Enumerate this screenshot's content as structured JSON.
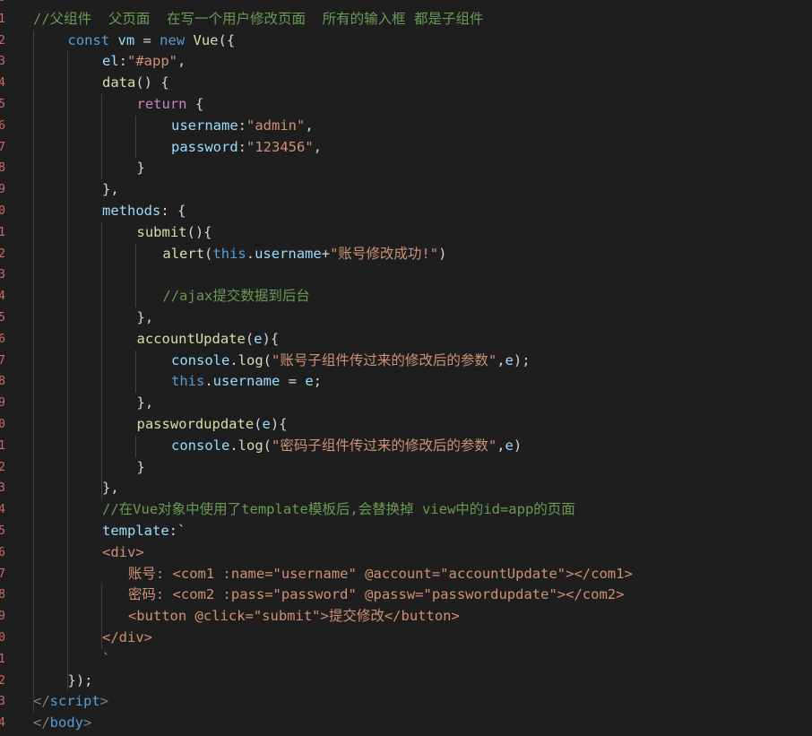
{
  "editor": {
    "line_numbers": [
      "0",
      "1",
      "2",
      "3",
      "4",
      "5",
      "6",
      "7",
      "8",
      "9",
      "0",
      "1",
      "2",
      "3",
      "4",
      "5",
      "6",
      "7",
      "8",
      "9",
      "0",
      "1",
      "2",
      "3",
      "4",
      "5",
      "6",
      "7",
      "8",
      "9",
      "0",
      "1",
      "2",
      "3",
      "4"
    ],
    "lines": [
      {
        "indent": 0,
        "tokens": []
      },
      {
        "indent": 0,
        "tokens": [
          {
            "t": "//父组件  父页面  在写一个用户修改页面  所有的输入框 都是子组件",
            "c": "c-cmt"
          }
        ]
      },
      {
        "indent": 1,
        "tokens": [
          {
            "t": "const ",
            "c": "c-kw"
          },
          {
            "t": "vm",
            "c": "c-var"
          },
          {
            "t": " = ",
            "c": "c-txt"
          },
          {
            "t": "new ",
            "c": "c-kw"
          },
          {
            "t": "Vue",
            "c": "c-fn"
          },
          {
            "t": "({",
            "c": "c-txt"
          }
        ]
      },
      {
        "indent": 2,
        "tokens": [
          {
            "t": "el",
            "c": "c-var"
          },
          {
            "t": ":",
            "c": "c-txt"
          },
          {
            "t": "\"#app\"",
            "c": "c-str"
          },
          {
            "t": ",",
            "c": "c-txt"
          }
        ]
      },
      {
        "indent": 2,
        "tokens": [
          {
            "t": "data",
            "c": "c-fn"
          },
          {
            "t": "() {",
            "c": "c-txt"
          }
        ]
      },
      {
        "indent": 3,
        "tokens": [
          {
            "t": "return",
            "c": "c-ctl"
          },
          {
            "t": " {",
            "c": "c-txt"
          }
        ]
      },
      {
        "indent": 4,
        "tokens": [
          {
            "t": "username",
            "c": "c-var"
          },
          {
            "t": ":",
            "c": "c-txt"
          },
          {
            "t": "\"admin\"",
            "c": "c-str"
          },
          {
            "t": ",",
            "c": "c-txt"
          }
        ]
      },
      {
        "indent": 4,
        "tokens": [
          {
            "t": "password",
            "c": "c-var"
          },
          {
            "t": ":",
            "c": "c-txt"
          },
          {
            "t": "\"123456\"",
            "c": "c-str"
          },
          {
            "t": ",",
            "c": "c-txt"
          }
        ]
      },
      {
        "indent": 3,
        "tokens": [
          {
            "t": "}",
            "c": "c-txt"
          }
        ]
      },
      {
        "indent": 2,
        "tokens": [
          {
            "t": "},",
            "c": "c-txt"
          }
        ]
      },
      {
        "indent": 2,
        "tokens": [
          {
            "t": "methods",
            "c": "c-var"
          },
          {
            "t": ": {",
            "c": "c-txt"
          }
        ]
      },
      {
        "indent": 3,
        "tokens": [
          {
            "t": "submit",
            "c": "c-fn"
          },
          {
            "t": "(){",
            "c": "c-txt"
          }
        ]
      },
      {
        "indent": 3.75,
        "tokens": [
          {
            "t": "alert",
            "c": "c-fn"
          },
          {
            "t": "(",
            "c": "c-txt"
          },
          {
            "t": "this",
            "c": "c-kw"
          },
          {
            "t": ".",
            "c": "c-txt"
          },
          {
            "t": "username",
            "c": "c-var"
          },
          {
            "t": "+",
            "c": "c-txt"
          },
          {
            "t": "\"账号修改成功!\"",
            "c": "c-str"
          },
          {
            "t": ")",
            "c": "c-txt"
          }
        ]
      },
      {
        "indent": 0,
        "tokens": []
      },
      {
        "indent": 3.75,
        "tokens": [
          {
            "t": "//ajax提交数据到后台",
            "c": "c-cmt"
          }
        ]
      },
      {
        "indent": 3,
        "tokens": [
          {
            "t": "},",
            "c": "c-txt"
          }
        ]
      },
      {
        "indent": 3,
        "tokens": [
          {
            "t": "accountUpdate",
            "c": "c-fn"
          },
          {
            "t": "(",
            "c": "c-txt"
          },
          {
            "t": "e",
            "c": "c-var"
          },
          {
            "t": "){",
            "c": "c-txt"
          }
        ]
      },
      {
        "indent": 4,
        "tokens": [
          {
            "t": "console",
            "c": "c-var"
          },
          {
            "t": ".",
            "c": "c-txt"
          },
          {
            "t": "log",
            "c": "c-fn"
          },
          {
            "t": "(",
            "c": "c-txt"
          },
          {
            "t": "\"账号子组件传过来的修改后的参数\"",
            "c": "c-str"
          },
          {
            "t": ",",
            "c": "c-txt"
          },
          {
            "t": "e",
            "c": "c-var"
          },
          {
            "t": ");",
            "c": "c-txt"
          }
        ]
      },
      {
        "indent": 4,
        "tokens": [
          {
            "t": "this",
            "c": "c-kw"
          },
          {
            "t": ".",
            "c": "c-txt"
          },
          {
            "t": "username",
            "c": "c-var"
          },
          {
            "t": " = ",
            "c": "c-txt"
          },
          {
            "t": "e",
            "c": "c-var"
          },
          {
            "t": ";",
            "c": "c-txt"
          }
        ]
      },
      {
        "indent": 3,
        "tokens": [
          {
            "t": "},",
            "c": "c-txt"
          }
        ]
      },
      {
        "indent": 3,
        "tokens": [
          {
            "t": "passwordupdate",
            "c": "c-fn"
          },
          {
            "t": "(",
            "c": "c-txt"
          },
          {
            "t": "e",
            "c": "c-var"
          },
          {
            "t": "){",
            "c": "c-txt"
          }
        ]
      },
      {
        "indent": 4,
        "tokens": [
          {
            "t": "console",
            "c": "c-var"
          },
          {
            "t": ".",
            "c": "c-txt"
          },
          {
            "t": "log",
            "c": "c-fn"
          },
          {
            "t": "(",
            "c": "c-txt"
          },
          {
            "t": "\"密码子组件传过来的修改后的参数\"",
            "c": "c-str"
          },
          {
            "t": ",",
            "c": "c-txt"
          },
          {
            "t": "e",
            "c": "c-var"
          },
          {
            "t": ")",
            "c": "c-txt"
          }
        ]
      },
      {
        "indent": 3,
        "tokens": [
          {
            "t": "}",
            "c": "c-txt"
          }
        ]
      },
      {
        "indent": 2,
        "tokens": [
          {
            "t": "},",
            "c": "c-txt"
          }
        ]
      },
      {
        "indent": 2,
        "tokens": [
          {
            "t": "//在Vue对象中使用了template模板后,会替换掉 view中的id=app的页面",
            "c": "c-cmt"
          }
        ]
      },
      {
        "indent": 2,
        "tokens": [
          {
            "t": "template",
            "c": "c-var"
          },
          {
            "t": ":`",
            "c": "c-txt"
          }
        ]
      },
      {
        "indent": 2,
        "tokens": [
          {
            "t": "<div>",
            "c": "c-str"
          }
        ]
      },
      {
        "indent": 2.75,
        "tokens": [
          {
            "t": "账号: <com1 :name=\"username\" @account=\"accountUpdate\"></com1>",
            "c": "c-str"
          }
        ]
      },
      {
        "indent": 2.75,
        "tokens": [
          {
            "t": "密码: <com2 :pass=\"password\" @passw=\"passwordupdate\"></com2>",
            "c": "c-str"
          }
        ]
      },
      {
        "indent": 2.75,
        "tokens": [
          {
            "t": "<button @click=\"submit\">提交修改</button>",
            "c": "c-str"
          }
        ]
      },
      {
        "indent": 2,
        "tokens": [
          {
            "t": "</div>",
            "c": "c-str"
          }
        ]
      },
      {
        "indent": 2,
        "tokens": [
          {
            "t": "`",
            "c": "c-str"
          }
        ]
      },
      {
        "indent": 1,
        "tokens": [
          {
            "t": "});",
            "c": "c-txt"
          }
        ]
      },
      {
        "indent": 0,
        "tokens": [
          {
            "t": "</",
            "c": "c-punc"
          },
          {
            "t": "script",
            "c": "c-tag"
          },
          {
            "t": ">",
            "c": "c-punc"
          }
        ]
      },
      {
        "indent": 0,
        "tokens": [
          {
            "t": "</",
            "c": "c-punc"
          },
          {
            "t": "body",
            "c": "c-tag"
          },
          {
            "t": ">",
            "c": "c-punc"
          }
        ]
      }
    ]
  }
}
